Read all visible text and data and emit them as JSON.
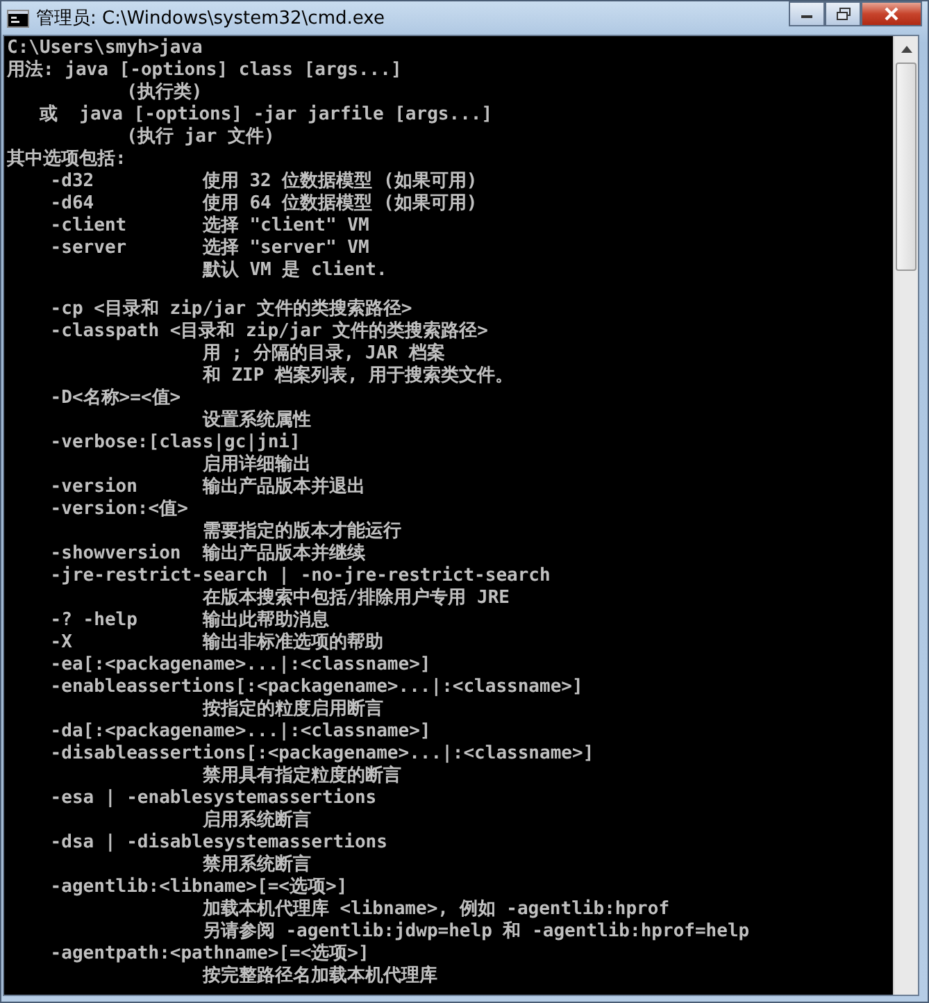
{
  "window": {
    "title": "管理员: C:\\Windows\\system32\\cmd.exe"
  },
  "console": {
    "blocks": [
      {
        "lines": [
          "C:\\Users\\smyh>java",
          "用法: java [-options] class [args...]",
          "           (执行类)",
          "   或  java [-options] -jar jarfile [args...]",
          "           (执行 jar 文件)",
          "其中选项包括:",
          "    -d32          使用 32 位数据模型 (如果可用)",
          "    -d64          使用 64 位数据模型 (如果可用)",
          "    -client       选择 \"client\" VM",
          "    -server       选择 \"server\" VM",
          "                  默认 VM 是 client."
        ]
      },
      {
        "lines": [
          "    -cp <目录和 zip/jar 文件的类搜索路径>",
          "    -classpath <目录和 zip/jar 文件的类搜索路径>",
          "                  用 ; 分隔的目录, JAR 档案",
          "                  和 ZIP 档案列表, 用于搜索类文件。",
          "    -D<名称>=<值>",
          "                  设置系统属性",
          "    -verbose:[class|gc|jni]",
          "                  启用详细输出",
          "    -version      输出产品版本并退出",
          "    -version:<值>",
          "                  需要指定的版本才能运行",
          "    -showversion  输出产品版本并继续",
          "    -jre-restrict-search | -no-jre-restrict-search",
          "                  在版本搜索中包括/排除用户专用 JRE",
          "    -? -help      输出此帮助消息",
          "    -X            输出非标准选项的帮助",
          "    -ea[:<packagename>...|:<classname>]",
          "    -enableassertions[:<packagename>...|:<classname>]",
          "                  按指定的粒度启用断言",
          "    -da[:<packagename>...|:<classname>]",
          "    -disableassertions[:<packagename>...|:<classname>]",
          "                  禁用具有指定粒度的断言",
          "    -esa | -enablesystemassertions",
          "                  启用系统断言",
          "    -dsa | -disablesystemassertions",
          "                  禁用系统断言",
          "    -agentlib:<libname>[=<选项>]",
          "                  加载本机代理库 <libname>, 例如 -agentlib:hprof",
          "                  另请参阅 -agentlib:jdwp=help 和 -agentlib:hprof=help",
          "    -agentpath:<pathname>[=<选项>]",
          "                  按完整路径名加载本机代理库"
        ]
      }
    ]
  }
}
